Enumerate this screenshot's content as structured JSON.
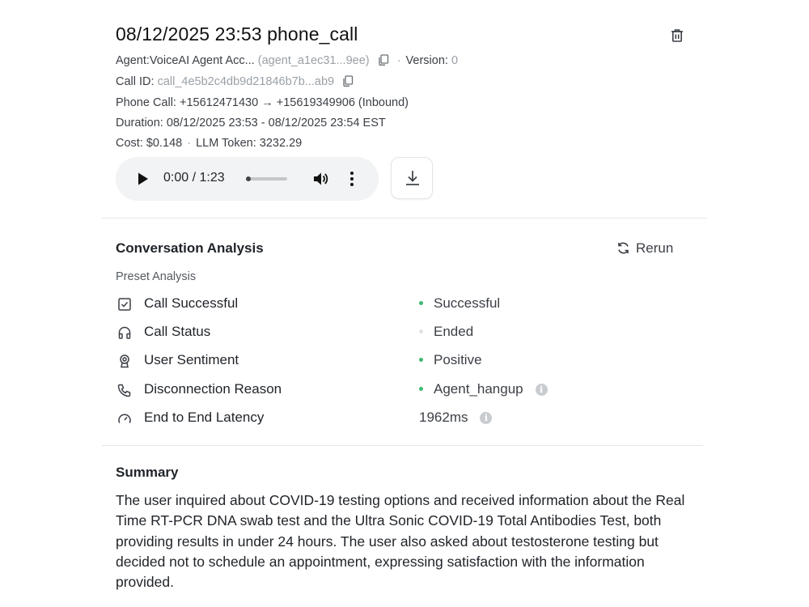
{
  "header": {
    "title": "08/12/2025 23:53 phone_call",
    "agent_label": "Agent:",
    "agent_name": "VoiceAI Agent Acc...",
    "agent_id": "agent_a1ec31...9ee",
    "version_label": "Version:",
    "version_value": "0",
    "call_id_label": "Call ID:",
    "call_id": "call_4e5b2c4db9d21846b7b...ab9",
    "phone_call_line": "Phone Call: +15612471430 → +15619349906 (Inbound)",
    "duration_line": "Duration: 08/12/2025 23:53 - 08/12/2025 23:54 EST",
    "cost": "Cost: $0.148",
    "llm_token": "LLM Token: 3232.29"
  },
  "player": {
    "time": "0:00 / 1:23",
    "progress": 0
  },
  "analysis": {
    "title": "Conversation Analysis",
    "rerun_label": "Rerun",
    "preset_label": "Preset Analysis",
    "rows": [
      {
        "icon": "checkbox-icon",
        "label": "Call Successful",
        "value": "Successful",
        "status_color": "#3fb871",
        "info": false
      },
      {
        "icon": "headphones-icon",
        "label": "Call Status",
        "value": "Ended",
        "status_color": "#dfe1e4",
        "info": false
      },
      {
        "icon": "award-icon",
        "label": "User Sentiment",
        "value": "Positive",
        "status_color": "#3fb871",
        "info": false
      },
      {
        "icon": "phone-icon",
        "label": "Disconnection Reason",
        "value": "Agent_hangup",
        "status_color": "#3fb871",
        "info": true
      },
      {
        "icon": "gauge-icon",
        "label": "End to End Latency",
        "value": "1962ms",
        "status_color": null,
        "info": true
      }
    ]
  },
  "summary": {
    "title": "Summary",
    "text": "The user inquired about COVID-19 testing options and received information about the Real Time RT-PCR DNA swab test and the Ultra Sonic COVID-19 Total Antibodies Test, both providing results in under 24 hours. The user also asked about testosterone testing but decided not to schedule an appointment, expressing satisfaction with the information provided."
  }
}
